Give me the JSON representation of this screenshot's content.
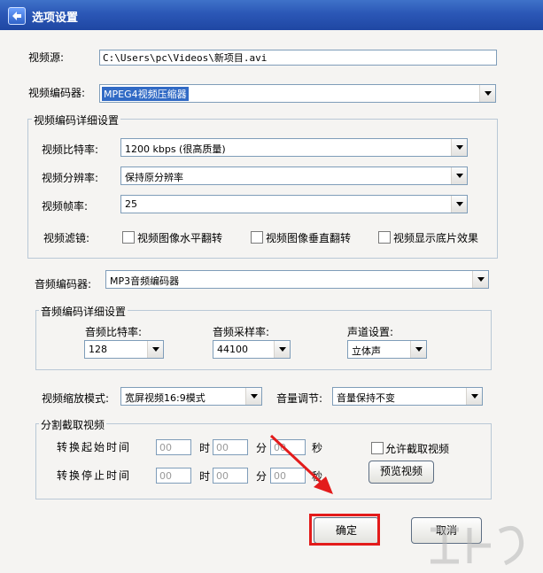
{
  "window": {
    "title": "选项设置"
  },
  "video": {
    "source_label": "视频源:",
    "source_value": "C:\\Users\\pc\\Videos\\新项目.avi",
    "encoder_label": "视频编码器:",
    "encoder_value": "MPEG4视频压缩器",
    "detail_group_title": "视频编码详细设置",
    "bitrate_label": "视频比特率:",
    "bitrate_value": "1200 kbps (很高质量)",
    "resolution_label": "视频分辨率:",
    "resolution_value": "保持原分辨率",
    "framerate_label": "视频帧率:",
    "framerate_value": "25",
    "filter_label": "视频滤镜:",
    "filter_hflip": "视频图像水平翻转",
    "filter_vflip": "视频图像垂直翻转",
    "filter_negative": "视频显示底片效果"
  },
  "audio": {
    "encoder_label": "音频编码器:",
    "encoder_value": "MP3音频编码器",
    "detail_group_title": "音频编码详细设置",
    "bitrate_label": "音频比特率:",
    "bitrate_value": "128",
    "samplerate_label": "音频采样率:",
    "samplerate_value": "44100",
    "channel_label": "声道设置:",
    "channel_value": "立体声"
  },
  "scale": {
    "mode_label": "视频缩放模式:",
    "mode_value": "宽屏视频16:9模式",
    "volume_label": "音量调节:",
    "volume_value": "音量保持不变"
  },
  "split": {
    "group_title": "分割截取视频",
    "start_label": "转换起始时间",
    "end_label": "转换停止时间",
    "hour_unit": "时",
    "minute_unit": "分",
    "second_unit": "秒",
    "start_h": "00",
    "start_m": "00",
    "start_s": "00",
    "end_h": "00",
    "end_m": "00",
    "end_s": "00",
    "allow_label": "允许截取视频",
    "preview_button": "预览视频"
  },
  "buttons": {
    "ok": "确定",
    "cancel": "取消"
  },
  "colors": {
    "titlebar": "#2b57b6",
    "highlight": "#e31b1b",
    "selection": "#316ac5"
  },
  "icons": {
    "app": "app-icon",
    "arrow": "red-arrow-annotation"
  }
}
